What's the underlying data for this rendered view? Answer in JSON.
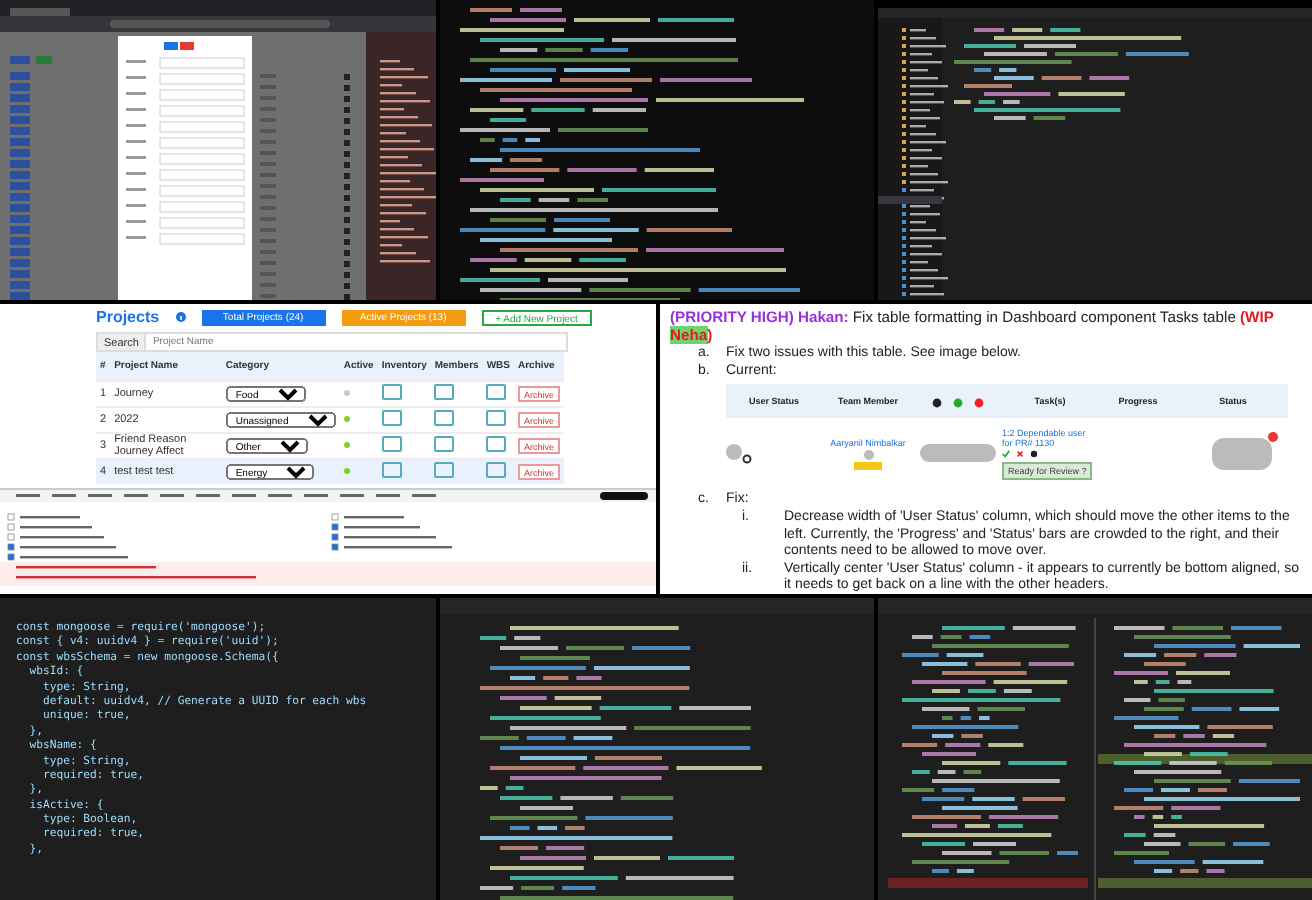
{
  "code_editor": {
    "lines": [
      "const mongoose = require('mongoose');",
      "const { v4: uuidv4 } = require('uuid');",
      "const wbsSchema = new mongoose.Schema({",
      "  wbsId: {",
      "    type: String,",
      "    default: uuidv4, // Generate a UUID for each wbs",
      "    unique: true,",
      "  },",
      "  wbsName: {",
      "    type: String,",
      "    required: true,",
      "  },",
      "  isActive: {",
      "    type: Boolean,",
      "    required: true,",
      "  },"
    ]
  },
  "projects_app": {
    "title": "Projects",
    "buttons": [
      {
        "label": "Total Projects (24)",
        "kind": "primary"
      },
      {
        "label": "Active Projects (13)",
        "kind": "warning"
      },
      {
        "label": "+ Add New Project",
        "kind": "outline"
      }
    ],
    "search": {
      "label": "Search",
      "placeholder": "Project Name"
    },
    "columns": [
      "#",
      "Project Name",
      "Category",
      "Active",
      "Inventory",
      "Members",
      "WBS",
      "Archive"
    ],
    "rows": [
      {
        "index": "1",
        "name": "Journey",
        "category": "Food",
        "active": false,
        "archive": "Archive",
        "selected": false
      },
      {
        "index": "2",
        "name": "2022",
        "category": "Unassigned",
        "active": true,
        "archive": "Archive",
        "selected": false
      },
      {
        "index": "3",
        "name": "Friend Reason Journey Affect",
        "category": "Other",
        "active": true,
        "archive": "Archive",
        "selected": false
      },
      {
        "index": "4",
        "name": "test test test",
        "category": "Energy",
        "active": true,
        "archive": "Archive",
        "selected": true
      }
    ]
  },
  "document": {
    "heading": {
      "priority": "(PRIORITY HIGH) Hakan:",
      "text": "Fix table formatting in Dashboard component Tasks table",
      "wip_open": "(WIP",
      "assignee": "Neha",
      "wip_close": ")"
    },
    "items": [
      {
        "marker": "a.",
        "text": "Fix two issues with this table. See image below."
      },
      {
        "marker": "b.",
        "text": "Current:"
      }
    ],
    "table": {
      "columns": [
        "User Status",
        "Team Member",
        "Task(s)",
        "Progress",
        "Status"
      ],
      "member": "Aaryanil Nimbalkar",
      "task": "1:2 Dependable user for PR# 1130",
      "review_button": "Ready for Review ?"
    },
    "fix": {
      "marker": "c.",
      "text": "Fix:",
      "steps": [
        {
          "marker": "i.",
          "text": "Decrease width of 'User Status' column, which should move the other items to the left. Currently, the 'Progress' and 'Status' bars are crowded to the right, and their contents need to be allowed to move over."
        },
        {
          "marker": "ii.",
          "text": "Vertically center 'User Status' column - it appears to currently be bottom aligned, so it needs to get back on a line with the other headers."
        }
      ]
    }
  }
}
